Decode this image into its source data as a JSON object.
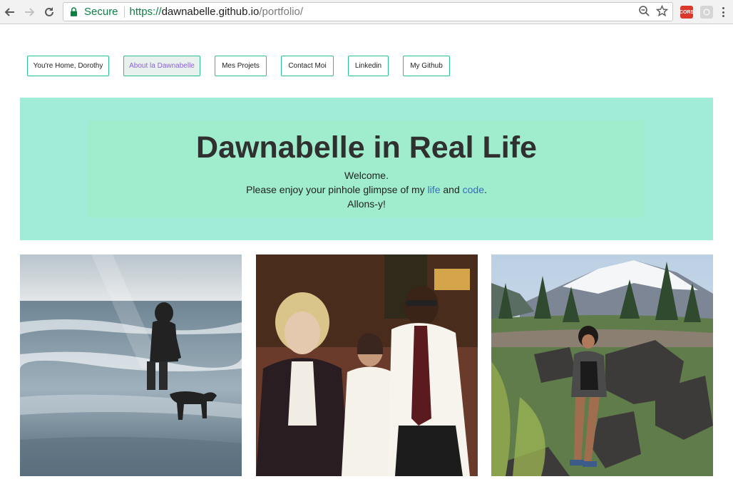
{
  "browser": {
    "secure_label": "Secure",
    "url_scheme": "https://",
    "url_domain": "dawnabelle.github.io",
    "url_path": "/portfolio/",
    "extension_cors_label": "CORS"
  },
  "nav": {
    "items": [
      {
        "label": "You're Home, Dorothy",
        "active": false
      },
      {
        "label": "About la Dawnabelle",
        "active": true
      },
      {
        "label": "Mes Projets",
        "active": false
      },
      {
        "label": "Contact Moi",
        "active": false
      },
      {
        "label": "Linkedin",
        "active": false
      },
      {
        "label": "My Github",
        "active": false
      }
    ]
  },
  "hero": {
    "title": "Dawnabelle in Real Life",
    "welcome": "Welcome.",
    "enjoy_prefix": "Please enjoy your pinhole glimpse of my ",
    "life_link": "life",
    "and_word": " and ",
    "code_link": "code",
    "period": ".",
    "sign_off": "Allons-y!"
  },
  "photos": [
    {
      "name": "beach-photo"
    },
    {
      "name": "family-photo"
    },
    {
      "name": "mountain-photo"
    }
  ],
  "colors": {
    "hero_bg": "#a0ecd8",
    "hero_inner_bg": "#9fedcc",
    "nav_border": "#2bbf8f",
    "active_text": "#8a62d8",
    "link": "#3a6bbd",
    "secure_green": "#0b8043"
  }
}
